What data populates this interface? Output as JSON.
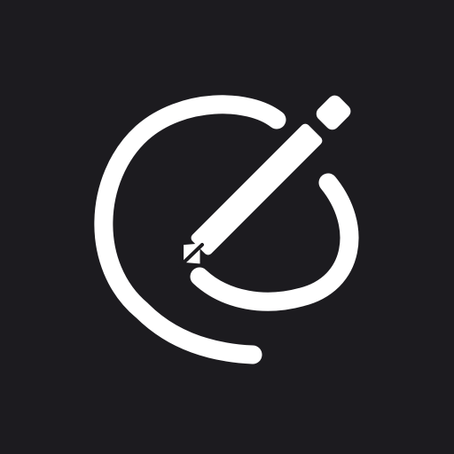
{
  "icon": {
    "name": "pencil-loop-logo",
    "background_color": "#1c1b1f",
    "foreground_color": "#ffffff"
  }
}
